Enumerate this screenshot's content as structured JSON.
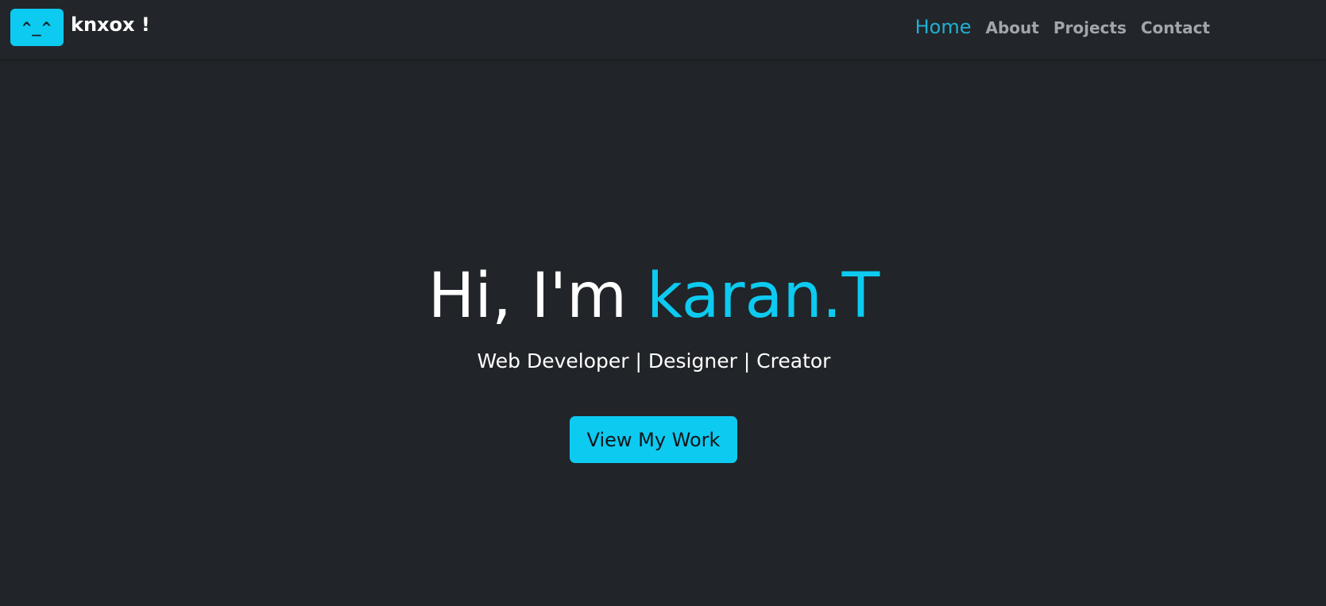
{
  "navbar": {
    "logo_text": "^_^",
    "brand": "knxox !",
    "links": [
      {
        "label": "Home",
        "active": true
      },
      {
        "label": "About",
        "active": false
      },
      {
        "label": "Projects",
        "active": false
      },
      {
        "label": "Contact",
        "active": false
      }
    ]
  },
  "hero": {
    "greeting": "Hi, I'm ",
    "name": "karan.T",
    "subtitle": "Web Developer | Designer | Creator",
    "cta_label": "View My Work"
  },
  "colors": {
    "background": "#212529",
    "accent": "#0dcaf0"
  }
}
